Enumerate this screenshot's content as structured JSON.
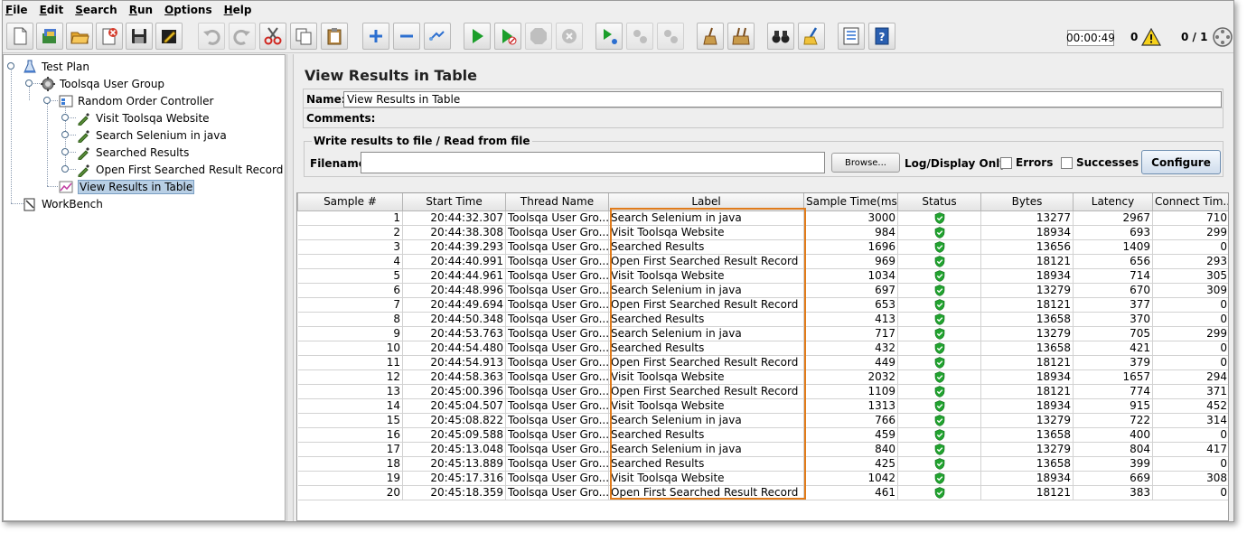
{
  "menu": [
    {
      "label": "File",
      "mn": "F",
      "rest": "ile"
    },
    {
      "label": "Edit",
      "mn": "E",
      "rest": "dit"
    },
    {
      "label": "Search",
      "mn": "S",
      "rest": "earch"
    },
    {
      "label": "Run",
      "mn": "R",
      "rest": "un"
    },
    {
      "label": "Options",
      "mn": "O",
      "rest": "ptions"
    },
    {
      "label": "Help",
      "mn": "H",
      "rest": "elp"
    }
  ],
  "toolbar": {
    "timer": "00:00:49",
    "error_count": "0",
    "thread_count": "0 / 1"
  },
  "tree": {
    "test_plan": "Test Plan",
    "thread_group": "Toolsqa User Group",
    "controller": "Random Order Controller",
    "samplers": [
      "Visit Toolsqa Website",
      "Search Selenium in java",
      "Searched Results",
      "Open First Searched Result Record"
    ],
    "listener": "View Results in Table",
    "workbench": "WorkBench"
  },
  "panel": {
    "title": "View Results in Table",
    "name_label": "Name:",
    "name_value": "View Results in Table",
    "comments_label": "Comments:",
    "file_group_legend": "Write results to file / Read from file",
    "filename_label": "Filename",
    "filename_value": "",
    "browse_label": "Browse...",
    "log_display_label": "Log/Display Only:",
    "errors_label": "Errors",
    "successes_label": "Successes",
    "configure_label": "Configure"
  },
  "table": {
    "columns": [
      "Sample #",
      "Start Time",
      "Thread Name",
      "Label",
      "Sample Time(ms)",
      "Status",
      "Bytes",
      "Latency",
      "Connect Tim..."
    ],
    "rows": [
      [
        "1",
        "20:44:32.307",
        "Toolsqa User Gro...",
        "Search Selenium in java",
        "3000",
        "13277",
        "2967",
        "710"
      ],
      [
        "2",
        "20:44:38.308",
        "Toolsqa User Gro...",
        "Visit Toolsqa Website",
        "984",
        "18934",
        "693",
        "299"
      ],
      [
        "3",
        "20:44:39.293",
        "Toolsqa User Gro...",
        "Searched Results",
        "1696",
        "13656",
        "1409",
        "0"
      ],
      [
        "4",
        "20:44:40.991",
        "Toolsqa User Gro...",
        "Open First Searched Result Record",
        "969",
        "18121",
        "656",
        "293"
      ],
      [
        "5",
        "20:44:44.961",
        "Toolsqa User Gro...",
        "Visit Toolsqa Website",
        "1034",
        "18934",
        "714",
        "305"
      ],
      [
        "6",
        "20:44:48.996",
        "Toolsqa User Gro...",
        "Search Selenium in java",
        "697",
        "13279",
        "670",
        "309"
      ],
      [
        "7",
        "20:44:49.694",
        "Toolsqa User Gro...",
        "Open First Searched Result Record",
        "653",
        "18121",
        "377",
        "0"
      ],
      [
        "8",
        "20:44:50.348",
        "Toolsqa User Gro...",
        "Searched Results",
        "413",
        "13658",
        "370",
        "0"
      ],
      [
        "9",
        "20:44:53.763",
        "Toolsqa User Gro...",
        "Search Selenium in java",
        "717",
        "13279",
        "705",
        "299"
      ],
      [
        "10",
        "20:44:54.480",
        "Toolsqa User Gro...",
        "Searched Results",
        "432",
        "13658",
        "421",
        "0"
      ],
      [
        "11",
        "20:44:54.913",
        "Toolsqa User Gro...",
        "Open First Searched Result Record",
        "449",
        "18121",
        "379",
        "0"
      ],
      [
        "12",
        "20:44:58.363",
        "Toolsqa User Gro...",
        "Visit Toolsqa Website",
        "2032",
        "18934",
        "1657",
        "294"
      ],
      [
        "13",
        "20:45:00.396",
        "Toolsqa User Gro...",
        "Open First Searched Result Record",
        "1109",
        "18121",
        "774",
        "371"
      ],
      [
        "14",
        "20:45:04.507",
        "Toolsqa User Gro...",
        "Visit Toolsqa Website",
        "1313",
        "18934",
        "915",
        "452"
      ],
      [
        "15",
        "20:45:08.822",
        "Toolsqa User Gro...",
        "Search Selenium in java",
        "766",
        "13279",
        "722",
        "314"
      ],
      [
        "16",
        "20:45:09.588",
        "Toolsqa User Gro...",
        "Searched Results",
        "459",
        "13658",
        "400",
        "0"
      ],
      [
        "17",
        "20:45:13.048",
        "Toolsqa User Gro...",
        "Search Selenium in java",
        "840",
        "13279",
        "804",
        "417"
      ],
      [
        "18",
        "20:45:13.889",
        "Toolsqa User Gro...",
        "Searched Results",
        "425",
        "13658",
        "399",
        "0"
      ],
      [
        "19",
        "20:45:17.316",
        "Toolsqa User Gro...",
        "Visit Toolsqa Website",
        "1042",
        "18934",
        "669",
        "308"
      ],
      [
        "20",
        "20:45:18.359",
        "Toolsqa User Gro...",
        "Open First Searched Result Record",
        "461",
        "18121",
        "383",
        "0"
      ]
    ],
    "status_icon": "green-shield-check-icon"
  },
  "colors": {
    "highlight": "#e07b1b",
    "status_success": "#21a32f",
    "selection": "#b8cfe5"
  }
}
